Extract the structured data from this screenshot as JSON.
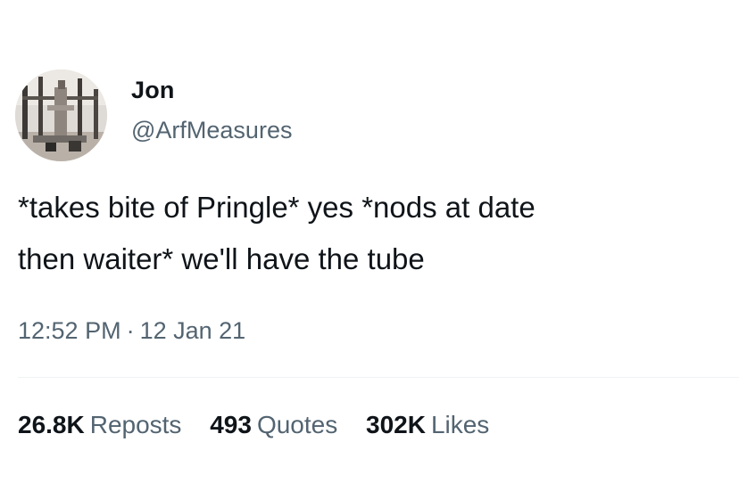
{
  "author": {
    "display_name": "Jon",
    "handle": "@ArfMeasures",
    "avatar": "profile-photo"
  },
  "tweet": {
    "lines": [
      "*takes bite of Pringle* yes *nods at date",
      "then waiter* we'll have the tube"
    ],
    "time": "12:52 PM",
    "separator": "·",
    "date": "12 Jan 21"
  },
  "stats": {
    "reposts": {
      "count": "26.8K",
      "label": "Reposts"
    },
    "quotes": {
      "count": "493",
      "label": "Quotes"
    },
    "likes": {
      "count": "302K",
      "label": "Likes"
    }
  },
  "colors": {
    "text": "#0f1419",
    "secondary": "#536471",
    "divider": "#eff3f4",
    "background": "#ffffff"
  }
}
